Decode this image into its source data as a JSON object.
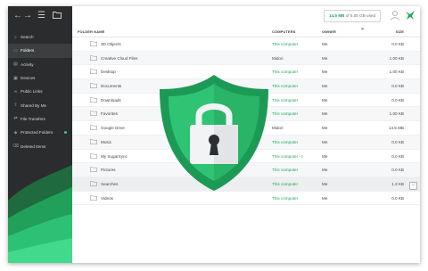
{
  "sidebar": {
    "items": [
      {
        "label": "Search",
        "icon": "search-icon"
      },
      {
        "label": "Folders",
        "icon": "folder-icon"
      },
      {
        "label": "Activity",
        "icon": "activity-icon"
      },
      {
        "label": "Devices",
        "icon": "devices-icon"
      },
      {
        "label": "Public Links",
        "icon": "link-icon"
      },
      {
        "label": "Shared By Me",
        "icon": "share-icon"
      },
      {
        "label": "File Transfers",
        "icon": "transfer-icon"
      },
      {
        "label": "Protected Folders",
        "icon": "shield-icon"
      },
      {
        "label": "Deleted Items",
        "icon": "trash-icon"
      }
    ]
  },
  "topbar": {
    "storage_used": "14.5 MB",
    "storage_rest": "of 5.00 GB used"
  },
  "table": {
    "headers": {
      "name": "FOLDER NAME",
      "computers": "COMPUTERS",
      "owner": "OWNER",
      "size": "SIZE"
    },
    "rows": [
      {
        "name": "3D Objects",
        "computer": "This computer",
        "owner": "Me",
        "size": "0.0 KB"
      },
      {
        "name": "Creative Cloud Files",
        "computer": "Midori",
        "owner": "Me",
        "size": "1.00 KB"
      },
      {
        "name": "Desktop",
        "computer": "This computer",
        "owner": "Me",
        "size": "1.00 KB"
      },
      {
        "name": "Documents",
        "computer": "This computer",
        "owner": "Me",
        "size": "0.0 KB"
      },
      {
        "name": "Downloads",
        "computer": "This computer",
        "owner": "Me",
        "size": "0.0 KB"
      },
      {
        "name": "Favorites",
        "computer": "This computer",
        "owner": "Me",
        "size": "1.00 KB"
      },
      {
        "name": "Google Drive",
        "computer": "Midori",
        "owner": "Me",
        "size": "14.5 MB"
      },
      {
        "name": "Music",
        "computer": "This computer",
        "owner": "Me",
        "size": "0.0 KB"
      },
      {
        "name": "My SugarSync",
        "computer": "This computer",
        "computer_extra": "+1",
        "owner": "Me",
        "size": "0.0 KB"
      },
      {
        "name": "Pictures",
        "computer": "This computer",
        "owner": "Me",
        "size": "0.0 KB"
      },
      {
        "name": "Searches",
        "computer": "This computer",
        "owner": "Me",
        "size": "1.3 KB"
      },
      {
        "name": "Videos",
        "computer": "This computer",
        "owner": "Me",
        "size": "0.0 KB"
      }
    ]
  },
  "colors": {
    "accent": "#1fa85a",
    "sidebar": "#2a2c2e",
    "shield_outer": "#1c9a55",
    "shield_inner": "#2fc474"
  }
}
